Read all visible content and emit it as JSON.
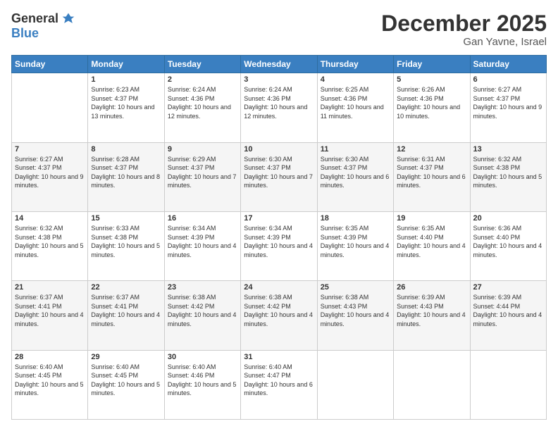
{
  "header": {
    "logo_general": "General",
    "logo_blue": "Blue",
    "month_title": "December 2025",
    "location": "Gan Yavne, Israel"
  },
  "weekdays": [
    "Sunday",
    "Monday",
    "Tuesday",
    "Wednesday",
    "Thursday",
    "Friday",
    "Saturday"
  ],
  "weeks": [
    [
      {
        "day": "",
        "content": ""
      },
      {
        "day": "1",
        "content": "Sunrise: 6:23 AM\nSunset: 4:37 PM\nDaylight: 10 hours\nand 13 minutes."
      },
      {
        "day": "2",
        "content": "Sunrise: 6:24 AM\nSunset: 4:36 PM\nDaylight: 10 hours\nand 12 minutes."
      },
      {
        "day": "3",
        "content": "Sunrise: 6:24 AM\nSunset: 4:36 PM\nDaylight: 10 hours\nand 12 minutes."
      },
      {
        "day": "4",
        "content": "Sunrise: 6:25 AM\nSunset: 4:36 PM\nDaylight: 10 hours\nand 11 minutes."
      },
      {
        "day": "5",
        "content": "Sunrise: 6:26 AM\nSunset: 4:36 PM\nDaylight: 10 hours\nand 10 minutes."
      },
      {
        "day": "6",
        "content": "Sunrise: 6:27 AM\nSunset: 4:37 PM\nDaylight: 10 hours\nand 9 minutes."
      }
    ],
    [
      {
        "day": "7",
        "content": "Sunrise: 6:27 AM\nSunset: 4:37 PM\nDaylight: 10 hours\nand 9 minutes."
      },
      {
        "day": "8",
        "content": "Sunrise: 6:28 AM\nSunset: 4:37 PM\nDaylight: 10 hours\nand 8 minutes."
      },
      {
        "day": "9",
        "content": "Sunrise: 6:29 AM\nSunset: 4:37 PM\nDaylight: 10 hours\nand 7 minutes."
      },
      {
        "day": "10",
        "content": "Sunrise: 6:30 AM\nSunset: 4:37 PM\nDaylight: 10 hours\nand 7 minutes."
      },
      {
        "day": "11",
        "content": "Sunrise: 6:30 AM\nSunset: 4:37 PM\nDaylight: 10 hours\nand 6 minutes."
      },
      {
        "day": "12",
        "content": "Sunrise: 6:31 AM\nSunset: 4:37 PM\nDaylight: 10 hours\nand 6 minutes."
      },
      {
        "day": "13",
        "content": "Sunrise: 6:32 AM\nSunset: 4:38 PM\nDaylight: 10 hours\nand 5 minutes."
      }
    ],
    [
      {
        "day": "14",
        "content": "Sunrise: 6:32 AM\nSunset: 4:38 PM\nDaylight: 10 hours\nand 5 minutes."
      },
      {
        "day": "15",
        "content": "Sunrise: 6:33 AM\nSunset: 4:38 PM\nDaylight: 10 hours\nand 5 minutes."
      },
      {
        "day": "16",
        "content": "Sunrise: 6:34 AM\nSunset: 4:39 PM\nDaylight: 10 hours\nand 4 minutes."
      },
      {
        "day": "17",
        "content": "Sunrise: 6:34 AM\nSunset: 4:39 PM\nDaylight: 10 hours\nand 4 minutes."
      },
      {
        "day": "18",
        "content": "Sunrise: 6:35 AM\nSunset: 4:39 PM\nDaylight: 10 hours\nand 4 minutes."
      },
      {
        "day": "19",
        "content": "Sunrise: 6:35 AM\nSunset: 4:40 PM\nDaylight: 10 hours\nand 4 minutes."
      },
      {
        "day": "20",
        "content": "Sunrise: 6:36 AM\nSunset: 4:40 PM\nDaylight: 10 hours\nand 4 minutes."
      }
    ],
    [
      {
        "day": "21",
        "content": "Sunrise: 6:37 AM\nSunset: 4:41 PM\nDaylight: 10 hours\nand 4 minutes."
      },
      {
        "day": "22",
        "content": "Sunrise: 6:37 AM\nSunset: 4:41 PM\nDaylight: 10 hours\nand 4 minutes."
      },
      {
        "day": "23",
        "content": "Sunrise: 6:38 AM\nSunset: 4:42 PM\nDaylight: 10 hours\nand 4 minutes."
      },
      {
        "day": "24",
        "content": "Sunrise: 6:38 AM\nSunset: 4:42 PM\nDaylight: 10 hours\nand 4 minutes."
      },
      {
        "day": "25",
        "content": "Sunrise: 6:38 AM\nSunset: 4:43 PM\nDaylight: 10 hours\nand 4 minutes."
      },
      {
        "day": "26",
        "content": "Sunrise: 6:39 AM\nSunset: 4:43 PM\nDaylight: 10 hours\nand 4 minutes."
      },
      {
        "day": "27",
        "content": "Sunrise: 6:39 AM\nSunset: 4:44 PM\nDaylight: 10 hours\nand 4 minutes."
      }
    ],
    [
      {
        "day": "28",
        "content": "Sunrise: 6:40 AM\nSunset: 4:45 PM\nDaylight: 10 hours\nand 5 minutes."
      },
      {
        "day": "29",
        "content": "Sunrise: 6:40 AM\nSunset: 4:45 PM\nDaylight: 10 hours\nand 5 minutes."
      },
      {
        "day": "30",
        "content": "Sunrise: 6:40 AM\nSunset: 4:46 PM\nDaylight: 10 hours\nand 5 minutes."
      },
      {
        "day": "31",
        "content": "Sunrise: 6:40 AM\nSunset: 4:47 PM\nDaylight: 10 hours\nand 6 minutes."
      },
      {
        "day": "",
        "content": ""
      },
      {
        "day": "",
        "content": ""
      },
      {
        "day": "",
        "content": ""
      }
    ]
  ]
}
